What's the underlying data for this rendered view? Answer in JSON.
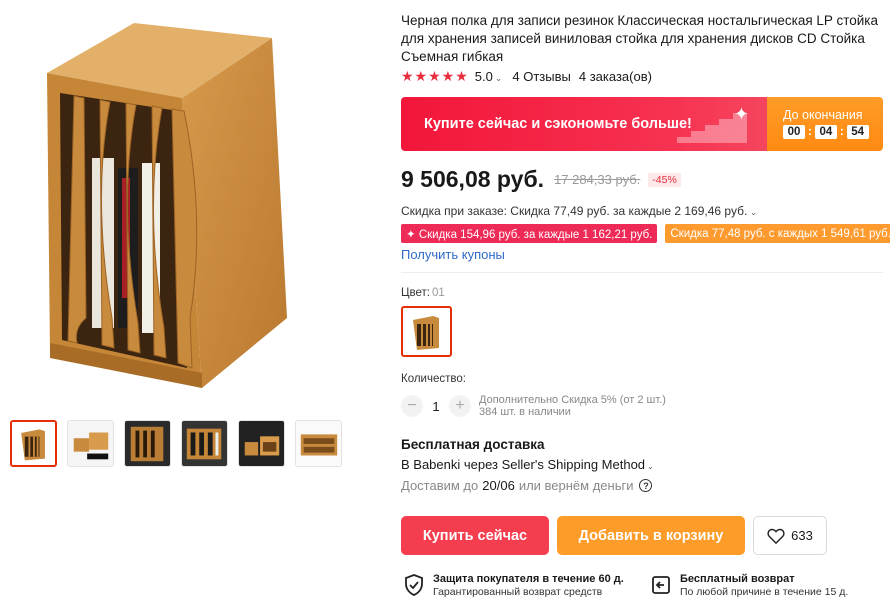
{
  "product": {
    "title": "Черная полка для записи резинок Классическая ностальгическая LP стойка для хранения записей виниловая стойка для хранения дисков CD Стойка Съемная гибкая"
  },
  "rating": {
    "stars": "★★★★★",
    "value": "5.0",
    "reviews": "4 Отзывы",
    "orders": "4 заказа(ов)"
  },
  "promo": {
    "text": "Купите сейчас и сэкономьте больше!",
    "countdown_label": "До окончания",
    "hours": "00",
    "minutes": "04",
    "seconds": "54"
  },
  "price": {
    "current": "9 506,08 руб.",
    "old": "17 284,33 руб.",
    "discount": "-45%"
  },
  "order_discount": "Скидка при заказе: Скидка 77,49 руб. за каждые 2 169,46 руб.",
  "coupons": [
    "✦ Скидка 154,96 руб. за каждые 1 162,21 руб.",
    "Скидка 77,48 руб. с каждых 1 549,61 руб."
  ],
  "get_coupons": "Получить купоны",
  "color": {
    "label": "Цвет:",
    "value": "01"
  },
  "quantity": {
    "label": "Количество:",
    "value": "1",
    "minus": "−",
    "plus": "+",
    "extra_discount": "Дополнительно Скидка 5% (от 2 шт.)",
    "stock": "384 шт. в наличии"
  },
  "shipping": {
    "title": "Бесплатная доставка",
    "method": "В Babenki через Seller's Shipping Method",
    "date_prefix": "Доставим до",
    "date": "20/06",
    "date_suffix": "или вернём деньги"
  },
  "actions": {
    "buy": "Купить сейчас",
    "cart": "Добавить в корзину",
    "wishlist_count": "633"
  },
  "guarantees": [
    {
      "title": "Защита покупателя в течение 60 д.",
      "subtitle": "Гарантированный возврат средств"
    },
    {
      "title": "Бесплатный возврат",
      "subtitle": "По любой причине в течение 15 д."
    }
  ],
  "colors": {
    "accent_red": "#f43e4f",
    "accent_orange": "#fd9c28",
    "link_blue": "#2f6ac7",
    "star_red": "#e62e3d"
  }
}
